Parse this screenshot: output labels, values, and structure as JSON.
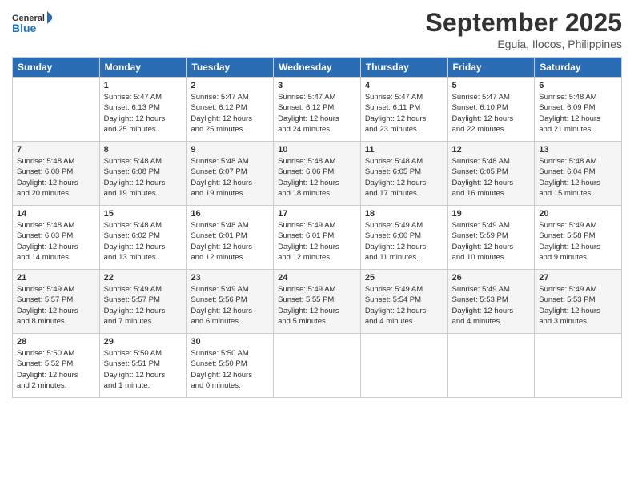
{
  "header": {
    "logo_line1": "General",
    "logo_line2": "Blue",
    "month": "September 2025",
    "location": "Eguia, Ilocos, Philippines"
  },
  "days_of_week": [
    "Sunday",
    "Monday",
    "Tuesday",
    "Wednesday",
    "Thursday",
    "Friday",
    "Saturday"
  ],
  "weeks": [
    [
      {
        "day": "",
        "info": ""
      },
      {
        "day": "1",
        "info": "Sunrise: 5:47 AM\nSunset: 6:13 PM\nDaylight: 12 hours\nand 25 minutes."
      },
      {
        "day": "2",
        "info": "Sunrise: 5:47 AM\nSunset: 6:12 PM\nDaylight: 12 hours\nand 25 minutes."
      },
      {
        "day": "3",
        "info": "Sunrise: 5:47 AM\nSunset: 6:12 PM\nDaylight: 12 hours\nand 24 minutes."
      },
      {
        "day": "4",
        "info": "Sunrise: 5:47 AM\nSunset: 6:11 PM\nDaylight: 12 hours\nand 23 minutes."
      },
      {
        "day": "5",
        "info": "Sunrise: 5:47 AM\nSunset: 6:10 PM\nDaylight: 12 hours\nand 22 minutes."
      },
      {
        "day": "6",
        "info": "Sunrise: 5:48 AM\nSunset: 6:09 PM\nDaylight: 12 hours\nand 21 minutes."
      }
    ],
    [
      {
        "day": "7",
        "info": "Sunrise: 5:48 AM\nSunset: 6:08 PM\nDaylight: 12 hours\nand 20 minutes."
      },
      {
        "day": "8",
        "info": "Sunrise: 5:48 AM\nSunset: 6:08 PM\nDaylight: 12 hours\nand 19 minutes."
      },
      {
        "day": "9",
        "info": "Sunrise: 5:48 AM\nSunset: 6:07 PM\nDaylight: 12 hours\nand 19 minutes."
      },
      {
        "day": "10",
        "info": "Sunrise: 5:48 AM\nSunset: 6:06 PM\nDaylight: 12 hours\nand 18 minutes."
      },
      {
        "day": "11",
        "info": "Sunrise: 5:48 AM\nSunset: 6:05 PM\nDaylight: 12 hours\nand 17 minutes."
      },
      {
        "day": "12",
        "info": "Sunrise: 5:48 AM\nSunset: 6:05 PM\nDaylight: 12 hours\nand 16 minutes."
      },
      {
        "day": "13",
        "info": "Sunrise: 5:48 AM\nSunset: 6:04 PM\nDaylight: 12 hours\nand 15 minutes."
      }
    ],
    [
      {
        "day": "14",
        "info": "Sunrise: 5:48 AM\nSunset: 6:03 PM\nDaylight: 12 hours\nand 14 minutes."
      },
      {
        "day": "15",
        "info": "Sunrise: 5:48 AM\nSunset: 6:02 PM\nDaylight: 12 hours\nand 13 minutes."
      },
      {
        "day": "16",
        "info": "Sunrise: 5:48 AM\nSunset: 6:01 PM\nDaylight: 12 hours\nand 12 minutes."
      },
      {
        "day": "17",
        "info": "Sunrise: 5:49 AM\nSunset: 6:01 PM\nDaylight: 12 hours\nand 12 minutes."
      },
      {
        "day": "18",
        "info": "Sunrise: 5:49 AM\nSunset: 6:00 PM\nDaylight: 12 hours\nand 11 minutes."
      },
      {
        "day": "19",
        "info": "Sunrise: 5:49 AM\nSunset: 5:59 PM\nDaylight: 12 hours\nand 10 minutes."
      },
      {
        "day": "20",
        "info": "Sunrise: 5:49 AM\nSunset: 5:58 PM\nDaylight: 12 hours\nand 9 minutes."
      }
    ],
    [
      {
        "day": "21",
        "info": "Sunrise: 5:49 AM\nSunset: 5:57 PM\nDaylight: 12 hours\nand 8 minutes."
      },
      {
        "day": "22",
        "info": "Sunrise: 5:49 AM\nSunset: 5:57 PM\nDaylight: 12 hours\nand 7 minutes."
      },
      {
        "day": "23",
        "info": "Sunrise: 5:49 AM\nSunset: 5:56 PM\nDaylight: 12 hours\nand 6 minutes."
      },
      {
        "day": "24",
        "info": "Sunrise: 5:49 AM\nSunset: 5:55 PM\nDaylight: 12 hours\nand 5 minutes."
      },
      {
        "day": "25",
        "info": "Sunrise: 5:49 AM\nSunset: 5:54 PM\nDaylight: 12 hours\nand 4 minutes."
      },
      {
        "day": "26",
        "info": "Sunrise: 5:49 AM\nSunset: 5:53 PM\nDaylight: 12 hours\nand 4 minutes."
      },
      {
        "day": "27",
        "info": "Sunrise: 5:49 AM\nSunset: 5:53 PM\nDaylight: 12 hours\nand 3 minutes."
      }
    ],
    [
      {
        "day": "28",
        "info": "Sunrise: 5:50 AM\nSunset: 5:52 PM\nDaylight: 12 hours\nand 2 minutes."
      },
      {
        "day": "29",
        "info": "Sunrise: 5:50 AM\nSunset: 5:51 PM\nDaylight: 12 hours\nand 1 minute."
      },
      {
        "day": "30",
        "info": "Sunrise: 5:50 AM\nSunset: 5:50 PM\nDaylight: 12 hours\nand 0 minutes."
      },
      {
        "day": "",
        "info": ""
      },
      {
        "day": "",
        "info": ""
      },
      {
        "day": "",
        "info": ""
      },
      {
        "day": "",
        "info": ""
      }
    ]
  ]
}
